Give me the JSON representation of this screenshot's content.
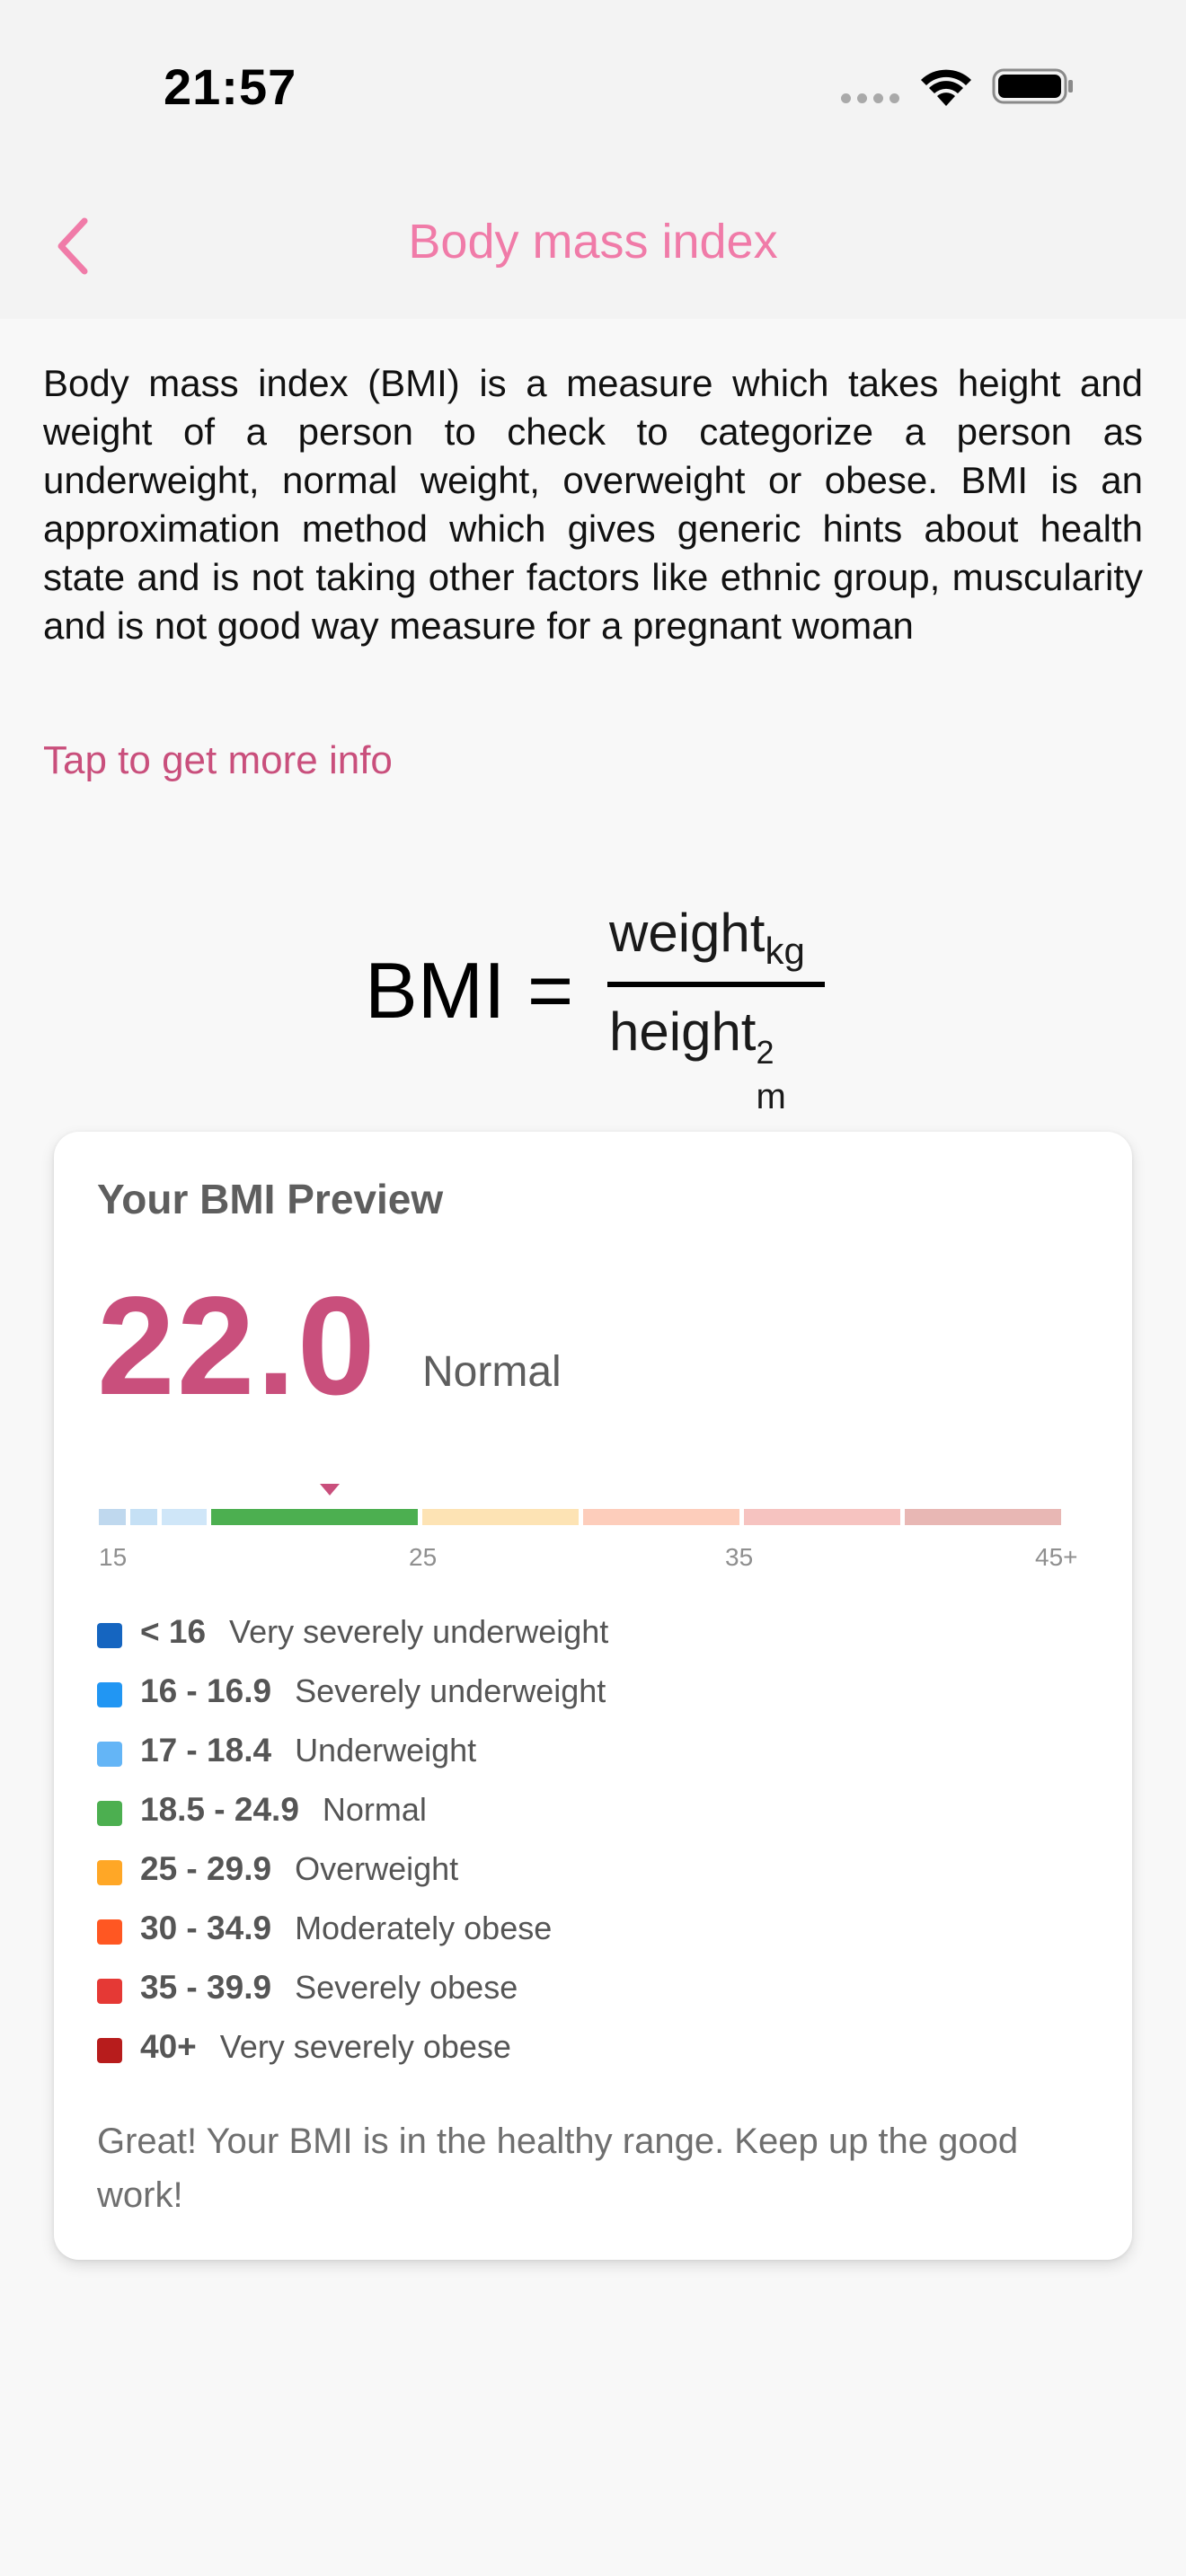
{
  "status_bar": {
    "time": "21:57"
  },
  "nav": {
    "title": "Body mass index",
    "back_icon": "chevron-left-icon",
    "accent_color": "#f07ba8"
  },
  "intro": {
    "text": "Body mass index (BMI) is a measure which takes height and weight of a person to check to categorize a person as underweight, normal weight, overweight or obese. BMI is an approximation method which gives generic hints about health state and is not taking other factors like ethnic group, muscularity and is not good way measure for a pregnant woman",
    "link": "Tap to get more info"
  },
  "formula": {
    "lhs": "BMI =",
    "numerator": "weight",
    "numerator_sub": "kg",
    "denominator": "height",
    "denominator_sup": "2",
    "denominator_sub": "m"
  },
  "preview": {
    "title": "Your BMI Preview",
    "value": "22.0",
    "category": "Normal",
    "value_color": "#c94f7c",
    "scale_ticks": [
      "15",
      "25",
      "35",
      "45+"
    ],
    "scale_segments": [
      {
        "color": "#bfd8ee"
      },
      {
        "color": "#c5e0f5"
      },
      {
        "color": "#cfe6f8"
      },
      {
        "color": "#4caf50"
      },
      {
        "color": "#fde3b4"
      },
      {
        "color": "#fdcdbb"
      },
      {
        "color": "#f6c3c0"
      },
      {
        "color": "#e8b7b4"
      }
    ],
    "legend": [
      {
        "range": "< 16",
        "label": "Very severely underweight",
        "color": "#1565c0"
      },
      {
        "range": "16 - 16.9",
        "label": "Severely underweight",
        "color": "#2196f3"
      },
      {
        "range": "17 - 18.4",
        "label": "Underweight",
        "color": "#64b5f6"
      },
      {
        "range": "18.5 - 24.9",
        "label": "Normal",
        "color": "#4caf50"
      },
      {
        "range": "25 - 29.9",
        "label": "Overweight",
        "color": "#ffa726"
      },
      {
        "range": "30 - 34.9",
        "label": "Moderately obese",
        "color": "#ff5722"
      },
      {
        "range": "35 - 39.9",
        "label": "Severely obese",
        "color": "#e53935"
      },
      {
        "range": "40+",
        "label": "Very severely obese",
        "color": "#b71c1c"
      }
    ],
    "feedback": "Great! Your BMI is in the healthy range. Keep up the good work!"
  }
}
